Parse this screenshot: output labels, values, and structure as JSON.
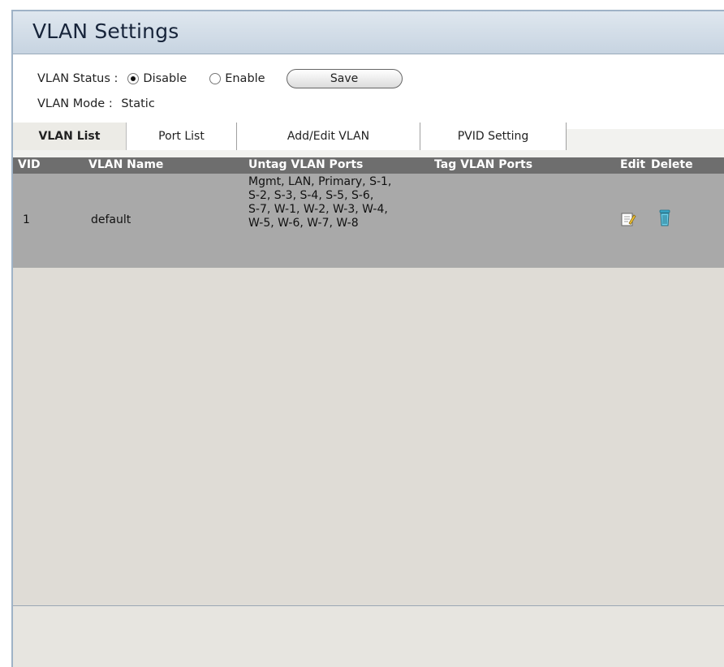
{
  "page": {
    "title": "VLAN Settings"
  },
  "settings": {
    "status_label": "VLAN Status :",
    "status_options": [
      {
        "label": "Disable",
        "checked": true
      },
      {
        "label": "Enable",
        "checked": false
      }
    ],
    "save_label": "Save",
    "mode_label": "VLAN Mode :",
    "mode_value": "Static"
  },
  "tabs": [
    {
      "label": "VLAN List",
      "active": true
    },
    {
      "label": "Port List",
      "active": false
    },
    {
      "label": "Add/Edit VLAN",
      "active": false
    },
    {
      "label": "PVID Setting",
      "active": false
    }
  ],
  "table": {
    "headers": [
      "VID",
      "VLAN Name",
      "Untag VLAN Ports",
      "Tag VLAN Ports",
      "Edit",
      "Delete"
    ],
    "rows": [
      {
        "vid": "1",
        "name": "default",
        "untag_ports": "Mgmt, LAN, Primary, S-1,\nS-2, S-3, S-4, S-5, S-6,\nS-7, W-1, W-2, W-3, W-4,\nW-5, W-6, W-7, W-8",
        "tag_ports": "",
        "edit_icon": "edit-icon",
        "delete_icon": "trash-icon"
      }
    ]
  },
  "colors": {
    "title_bar": "#c7d4e1",
    "table_header": "#6e6e6e",
    "table_row": "#a9a9a9",
    "content_bg": "#dfdcd6",
    "delete_icon": "#3aa8c8"
  }
}
